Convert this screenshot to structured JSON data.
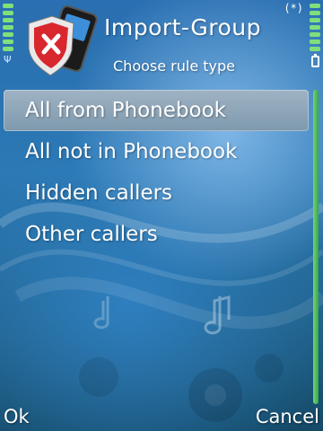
{
  "header": {
    "title": "Import-Group",
    "subtitle": "Choose rule type",
    "app_icon": "phone-shield-blocked-icon"
  },
  "status": {
    "signal_icon": "antenna-icon",
    "bluetooth_icon": "bluetooth-icon",
    "bluetooth_label": "(*)",
    "battery_icon": "battery-icon"
  },
  "list": {
    "items": [
      {
        "label": "All from Phonebook",
        "selected": true
      },
      {
        "label": "All not in Phonebook",
        "selected": false
      },
      {
        "label": "Hidden callers",
        "selected": false
      },
      {
        "label": "Other callers",
        "selected": false
      }
    ]
  },
  "softkeys": {
    "left": "Ok",
    "right": "Cancel"
  },
  "colors": {
    "accent_green": "#6fd57a",
    "highlight": "#8fa7ba",
    "background": "#2a6fb1"
  }
}
